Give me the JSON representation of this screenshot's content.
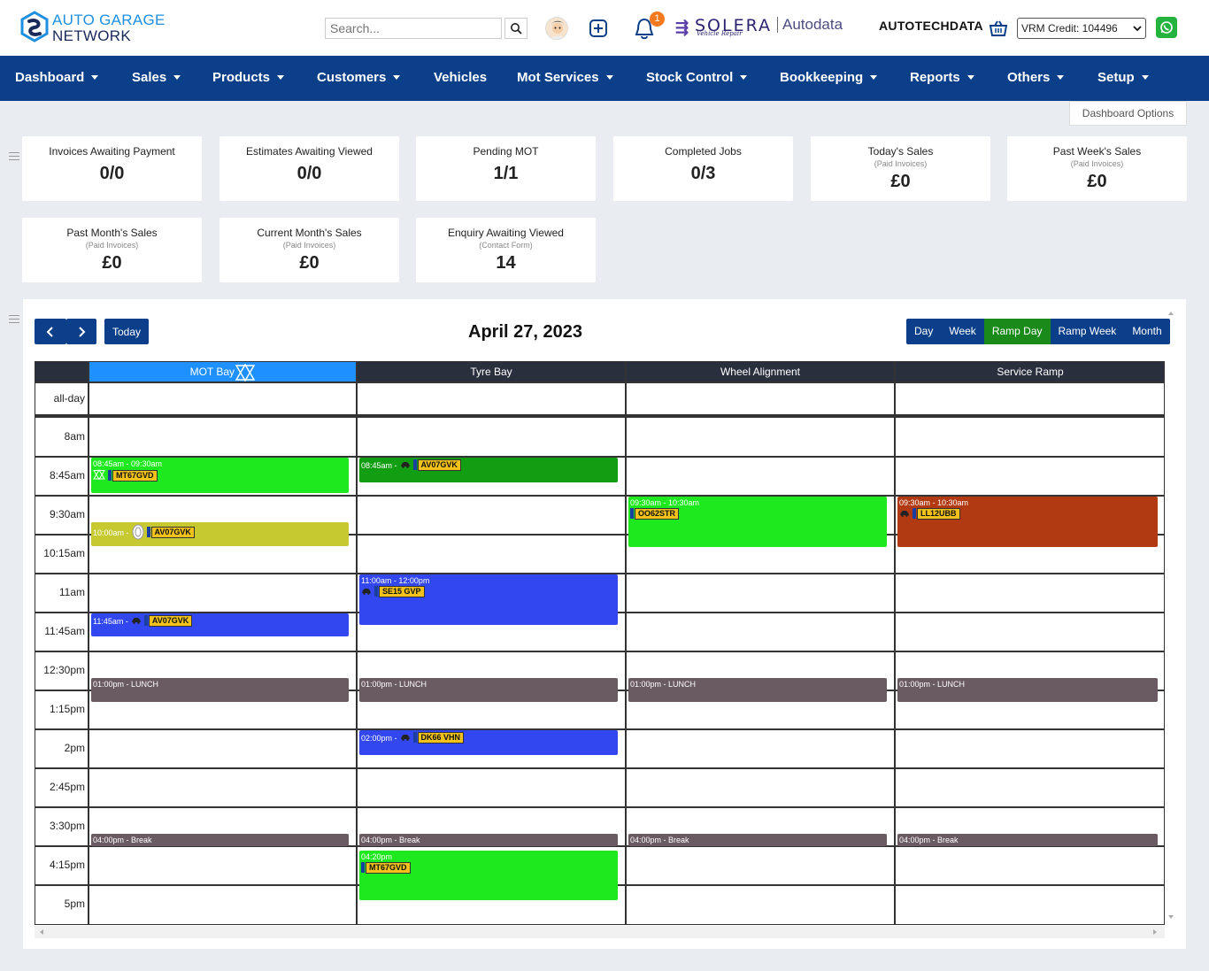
{
  "header": {
    "logo_line1": "AUTO GARAGE",
    "logo_line2": "NETWORK",
    "search_placeholder": "Search...",
    "notification_count": "1",
    "solera_name": "SOLERA",
    "solera_sub": "Vehicle Repair",
    "autodata_label": "Autodata",
    "autotechdata_label": "AUTOTECHDATA",
    "vrm_credit": "VRM Credit: 104496",
    "icons": [
      "search-icon",
      "user-avatar",
      "plus-square-icon",
      "bell-icon",
      "basket-icon",
      "whatsapp-icon"
    ]
  },
  "nav": {
    "items": [
      {
        "label": "Dashboard",
        "dropdown": true
      },
      {
        "label": "Sales",
        "dropdown": true
      },
      {
        "label": "Products",
        "dropdown": true
      },
      {
        "label": "Customers",
        "dropdown": true
      },
      {
        "label": "Vehicles",
        "dropdown": false
      },
      {
        "label": "Mot Services",
        "dropdown": true
      },
      {
        "label": "Stock Control",
        "dropdown": true
      },
      {
        "label": "Bookkeeping",
        "dropdown": true
      },
      {
        "label": "Reports",
        "dropdown": true
      },
      {
        "label": "Others",
        "dropdown": true
      },
      {
        "label": "Setup",
        "dropdown": true
      }
    ]
  },
  "dashboard_options_label": "Dashboard Options",
  "stats": [
    {
      "title": "Invoices Awaiting Payment",
      "sub": "",
      "value": "0/0"
    },
    {
      "title": "Estimates Awaiting Viewed",
      "sub": "",
      "value": "0/0"
    },
    {
      "title": "Pending MOT",
      "sub": "",
      "value": "1/1"
    },
    {
      "title": "Completed Jobs",
      "sub": "",
      "value": "0/3"
    },
    {
      "title": "Today's Sales",
      "sub": "(Paid Invoices)",
      "value": "£0"
    },
    {
      "title": "Past Week's Sales",
      "sub": "(Paid Invoices)",
      "value": "£0"
    },
    {
      "title": "Past Month's Sales",
      "sub": "(Paid Invoices)",
      "value": "£0"
    },
    {
      "title": "Current Month's Sales",
      "sub": "(Paid Invoices)",
      "value": "£0"
    },
    {
      "title": "Enquiry Awaiting Viewed",
      "sub": "(Contact Form)",
      "value": "14"
    }
  ],
  "calendar": {
    "title": "April 27, 2023",
    "today_label": "Today",
    "views": [
      "Day",
      "Week",
      "Ramp Day",
      "Ramp Week",
      "Month"
    ],
    "active_view": "Ramp Day",
    "resources": [
      "MOT Bay",
      "Tyre Bay",
      "Wheel Alignment",
      "Service Ramp"
    ],
    "allday_label": "all-day",
    "time_slots": [
      "8am",
      "8:45am",
      "9:30am",
      "10:15am",
      "11am",
      "11:45am",
      "12:30pm",
      "1:15pm",
      "2pm",
      "2:45pm",
      "3:30pm",
      "4:15pm",
      "5pm"
    ],
    "events": [
      {
        "resource": 0,
        "time": "08:45am - 09:30am",
        "plate": "MT67GVD",
        "color": "#1ee81e",
        "icon": "mot-icon",
        "start": 1,
        "end": 1.92
      },
      {
        "resource": 0,
        "time": "10:00am -",
        "plate": "AV07GVK",
        "color": "#c6c930",
        "icon": "tyre-icon",
        "start": 2.65,
        "end": 3.27
      },
      {
        "resource": 0,
        "time": "11:45am -",
        "plate": "AV07GVK",
        "color": "#3247f0",
        "icon": "car-icon",
        "start": 5,
        "end": 5.6
      },
      {
        "resource": 0,
        "time": "01:00pm - LUNCH",
        "plate": "",
        "color": "#6a5a62",
        "icon": "",
        "start": 6.65,
        "end": 7.27
      },
      {
        "resource": 0,
        "time": "04:00pm - Break",
        "plate": "",
        "color": "#6a5a62",
        "icon": "",
        "start": 10.65,
        "end": 10.97
      },
      {
        "resource": 1,
        "time": "08:45am -",
        "plate": "AV07GVK",
        "color": "#129e12",
        "icon": "car-icon",
        "start": 1,
        "end": 1.64
      },
      {
        "resource": 1,
        "time": "11:00am - 12:00pm",
        "plate": "SE15 GVP",
        "color": "#3247f0",
        "icon": "car-icon",
        "start": 4,
        "end": 5.3
      },
      {
        "resource": 1,
        "time": "01:00pm - LUNCH",
        "plate": "",
        "color": "#6a5a62",
        "icon": "",
        "start": 6.65,
        "end": 7.27
      },
      {
        "resource": 1,
        "time": "02:00pm -",
        "plate": "DK66 VHN",
        "color": "#3247f0",
        "icon": "car-icon",
        "start": 8,
        "end": 8.64
      },
      {
        "resource": 1,
        "time": "04:00pm - Break",
        "plate": "",
        "color": "#6a5a62",
        "icon": "",
        "start": 10.65,
        "end": 10.97
      },
      {
        "resource": 1,
        "time": "04:20pm",
        "plate": "MT67GVD",
        "color": "#1ee81e",
        "icon": "",
        "start": 11.08,
        "end": 12.37
      },
      {
        "resource": 2,
        "time": "09:30am - 10:30am",
        "plate": "OO62STR",
        "color": "#1ee81e",
        "icon": "",
        "start": 2,
        "end": 3.3
      },
      {
        "resource": 2,
        "time": "01:00pm - LUNCH",
        "plate": "",
        "color": "#6a5a62",
        "icon": "",
        "start": 6.65,
        "end": 7.27
      },
      {
        "resource": 2,
        "time": "04:00pm - Break",
        "plate": "",
        "color": "#6a5a62",
        "icon": "",
        "start": 10.65,
        "end": 10.97
      },
      {
        "resource": 3,
        "time": "09:30am - 10:30am",
        "plate": "LL12UBB",
        "color": "#b23a12",
        "icon": "car-icon",
        "start": 2,
        "end": 3.3
      },
      {
        "resource": 3,
        "time": "01:00pm - LUNCH",
        "plate": "",
        "color": "#6a5a62",
        "icon": "",
        "start": 6.65,
        "end": 7.27
      },
      {
        "resource": 3,
        "time": "04:00pm - Break",
        "plate": "",
        "color": "#6a5a62",
        "icon": "",
        "start": 10.65,
        "end": 10.97
      }
    ]
  }
}
